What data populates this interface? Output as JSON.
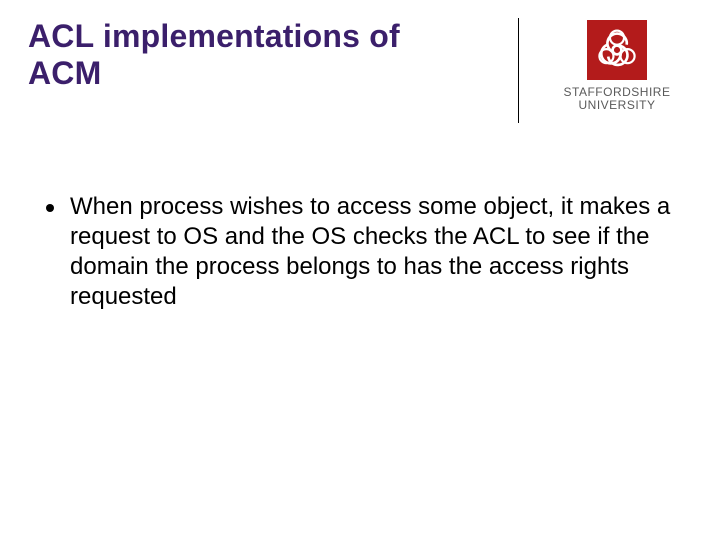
{
  "slide": {
    "title": "ACL implementations of ACM",
    "logo": {
      "institution_line1": "STAFFORDSHIRE",
      "institution_line2": "UNIVERSITY",
      "icon": "biohazard-icon",
      "brand_red": "#b31b1b"
    },
    "bullets": [
      "When process wishes to access some object, it makes a request to OS and the OS checks the ACL to see if the domain the process belongs to has the access rights requested"
    ]
  }
}
